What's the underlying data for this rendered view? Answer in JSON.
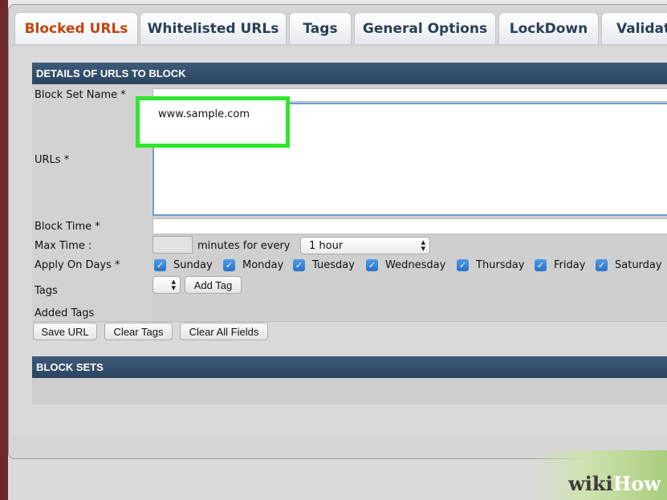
{
  "tabs": [
    {
      "label": "Blocked URLs",
      "active": true
    },
    {
      "label": "Whitelisted URLs",
      "active": false
    },
    {
      "label": "Tags",
      "active": false
    },
    {
      "label": "General Options",
      "active": false
    },
    {
      "label": "LockDown",
      "active": false
    },
    {
      "label": "Validate",
      "active": false
    }
  ],
  "details_section": {
    "header": "DETAILS OF URLS TO BLOCK",
    "block_set_name_label": "Block Set Name *",
    "urls_label": "URLs *",
    "urls_value": "www.sample.com",
    "block_time_label": "Block Time *",
    "max_time_label": "Max Time :",
    "minutes_for_every": "minutes for every",
    "interval_value": "1 hour",
    "apply_on_days_label": "Apply On Days *",
    "days": [
      {
        "label": "Sunday",
        "checked": true
      },
      {
        "label": "Monday",
        "checked": true
      },
      {
        "label": "Tuesday",
        "checked": true
      },
      {
        "label": "Wednesday",
        "checked": true
      },
      {
        "label": "Thursday",
        "checked": true
      },
      {
        "label": "Friday",
        "checked": true
      },
      {
        "label": "Saturday",
        "checked": true
      }
    ],
    "tags_label": "Tags",
    "add_tag_button": "Add Tag",
    "added_tags_label": "Added Tags"
  },
  "actions": {
    "save_url": "Save URL",
    "clear_tags": "Clear Tags",
    "clear_all_fields": "Clear All Fields"
  },
  "block_sets_section": {
    "header": "BLOCK SETS"
  },
  "watermark": {
    "wiki": "wiki",
    "how": "How"
  },
  "colors": {
    "active_tab": "#c1440e",
    "tab_text": "#2a3e54",
    "section_header": "#2b4560",
    "highlight": "#2ee62e",
    "checkbox": "#2a72c8"
  }
}
